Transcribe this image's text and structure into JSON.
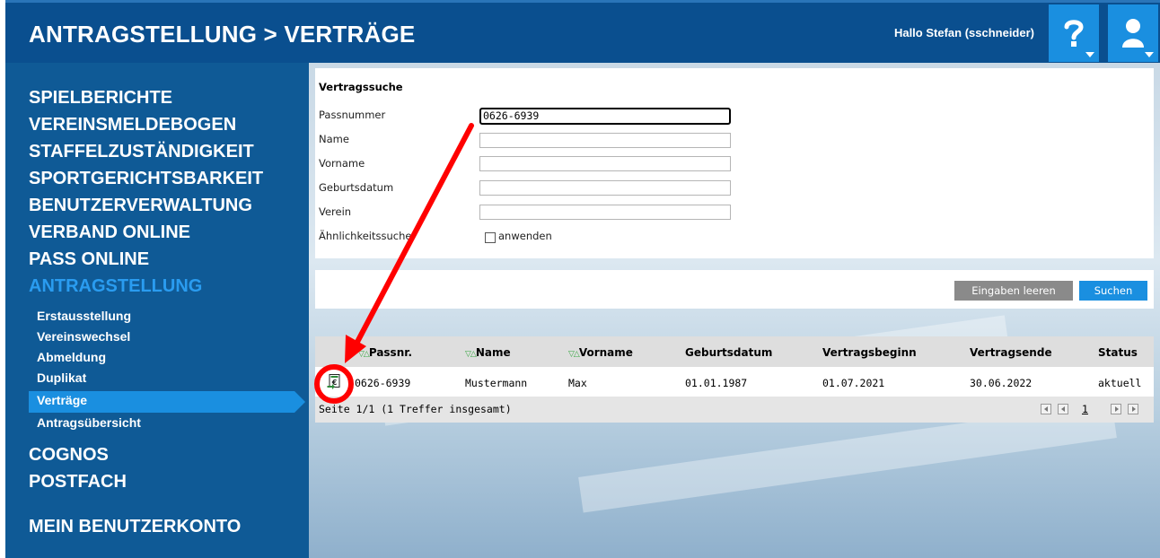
{
  "header": {
    "title": "ANTRAGSTELLUNG > VERTRÄGE",
    "greeting": "Hallo Stefan (sschneider)",
    "help_icon": "question-mark-icon",
    "user_icon": "user-icon",
    "colors": {
      "header_bg": "#0a4f8f",
      "accent": "#1a8fe0"
    }
  },
  "sidebar": {
    "main_items_top": [
      {
        "label": "SPIELBERICHTE"
      },
      {
        "label": "VEREINSMELDEBOGEN"
      },
      {
        "label": "STAFFELZUSTÄNDIGKEIT"
      },
      {
        "label": "SPORTGERICHTSBARKEIT"
      },
      {
        "label": "BENUTZERVERWALTUNG"
      },
      {
        "label": "VERBAND ONLINE"
      },
      {
        "label": "PASS ONLINE"
      },
      {
        "label": "ANTRAGSTELLUNG",
        "active": true
      }
    ],
    "sub_items": [
      {
        "label": "Erstausstellung"
      },
      {
        "label": "Vereinswechsel"
      },
      {
        "label": "Abmeldung"
      },
      {
        "label": "Duplikat"
      },
      {
        "label": "Verträge",
        "active": true
      },
      {
        "label": "Antragsübersicht"
      }
    ],
    "main_items_bottom": [
      {
        "label": "COGNOS"
      },
      {
        "label": "POSTFACH"
      }
    ],
    "account": {
      "label": "MEIN BENUTZERKONTO"
    }
  },
  "search": {
    "title": "Vertragssuche",
    "fields": [
      {
        "label": "Passnummer",
        "value": "0626-6939"
      },
      {
        "label": "Name",
        "value": ""
      },
      {
        "label": "Vorname",
        "value": ""
      },
      {
        "label": "Geburtsdatum",
        "value": ""
      },
      {
        "label": "Verein",
        "value": ""
      }
    ],
    "similarity": {
      "label": "Ähnlichkeitssuche",
      "checkbox_label": "anwenden",
      "checked": false
    }
  },
  "buttons": {
    "clear": "Eingaben leeren",
    "search": "Suchen"
  },
  "results": {
    "columns": [
      "Passnr.",
      "Name",
      "Vorname",
      "Geburtsdatum",
      "Vertragsbeginn",
      "Vertragsende",
      "Status"
    ],
    "sortable_indicator": "▽△",
    "rows": [
      {
        "icon": "contract-document-icon",
        "passnr": "0626-6939",
        "name": "Mustermann",
        "vorname": "Max",
        "geburtsdatum": "01.01.1987",
        "vertragsbeginn": "01.07.2021",
        "vertragsende": "30.06.2022",
        "status": "aktuell"
      }
    ],
    "pager": {
      "text": "Seite 1/1 (1 Treffer insgesamt)",
      "current_page": "1",
      "icons": [
        "first-page-icon",
        "prev-page-icon",
        "next-page-icon",
        "last-page-icon"
      ]
    }
  },
  "annotation": {
    "color": "#ff0000",
    "shapes": [
      "highlight-circle",
      "pointer-arrow"
    ]
  }
}
